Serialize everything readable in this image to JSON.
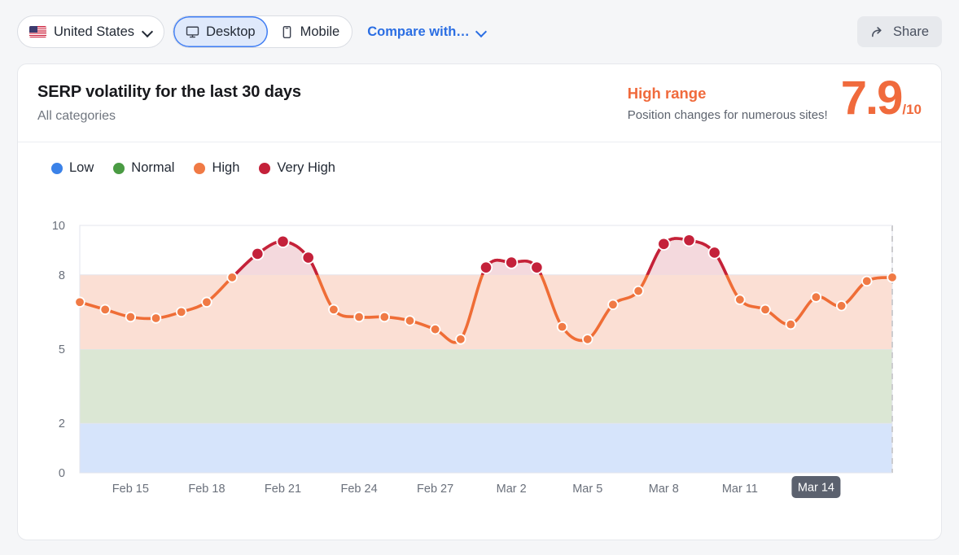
{
  "toolbar": {
    "country": {
      "label": "United States",
      "flag_icon": "us-flag-icon",
      "chevron_icon": "chevron-down-icon"
    },
    "device_desktop": {
      "label": "Desktop",
      "icon": "desktop-monitor-icon",
      "selected": true
    },
    "device_mobile": {
      "label": "Mobile",
      "icon": "mobile-phone-icon",
      "selected": false
    },
    "compare": {
      "label": "Compare with…",
      "chevron_icon": "chevron-down-icon",
      "color": "#2b6ee3"
    },
    "share": {
      "label": "Share",
      "icon": "share-arrow-icon"
    }
  },
  "card": {
    "title": "SERP volatility for the last 30 days",
    "subtitle": "All categories",
    "range_title": "High range",
    "range_desc": "Position changes for numerous sites!",
    "score": "7.9",
    "score_max": "/10",
    "accent_color": "#f06a3c"
  },
  "legend": [
    {
      "label": "Low",
      "color": "#3b82e8"
    },
    {
      "label": "Normal",
      "color": "#4a9b43"
    },
    {
      "label": "High",
      "color": "#f07a45"
    },
    {
      "label": "Very High",
      "color": "#c4213a"
    }
  ],
  "chart_data": {
    "type": "line",
    "title": "SERP volatility for the last 30 days",
    "xlabel": "",
    "ylabel": "",
    "ylim": [
      0,
      10
    ],
    "yticks": [
      0,
      2,
      5,
      8,
      10
    ],
    "grid": true,
    "legend_position": "top-left",
    "xticks": [
      "Feb 15",
      "Feb 18",
      "Feb 21",
      "Feb 24",
      "Feb 27",
      "Mar 2",
      "Mar 5",
      "Mar 8",
      "Mar 11",
      "Mar 14"
    ],
    "highlighted_xtick": "Mar 14",
    "bands": [
      {
        "label": "Low",
        "from": 0,
        "to": 2,
        "color": "#d6e4fb"
      },
      {
        "label": "Normal",
        "from": 2,
        "to": 5,
        "color": "#dbe7d4"
      },
      {
        "label": "High",
        "from": 5,
        "to": 8,
        "color": "#fbdfd4"
      },
      {
        "label": "Very High",
        "from": 8,
        "to": 10,
        "color": "#f4d9dd"
      }
    ],
    "series": [
      {
        "name": "SERP volatility",
        "line_color": "#ef6d36",
        "high_color": "#f07a45",
        "very_high_color": "#c4213a",
        "x": [
          "Feb 13",
          "Feb 14",
          "Feb 15",
          "Feb 16",
          "Feb 17",
          "Feb 18",
          "Feb 19",
          "Feb 20",
          "Feb 21",
          "Feb 22",
          "Feb 23",
          "Feb 24",
          "Feb 25",
          "Feb 26",
          "Feb 27",
          "Feb 28",
          "Mar 1",
          "Mar 2",
          "Mar 3",
          "Mar 4",
          "Mar 5",
          "Mar 6",
          "Mar 7",
          "Mar 8",
          "Mar 9",
          "Mar 10",
          "Mar 11",
          "Mar 12",
          "Mar 13",
          "Mar 14"
        ],
        "values": [
          6.9,
          6.6,
          6.3,
          6.25,
          6.5,
          6.9,
          7.9,
          8.85,
          9.35,
          8.7,
          6.6,
          6.3,
          6.3,
          6.15,
          5.8,
          5.4,
          8.3,
          8.5,
          8.3,
          5.9,
          5.4,
          6.8,
          7.35,
          9.25,
          9.4,
          8.9,
          7.0,
          6.6,
          6.0,
          7.1,
          6.75,
          7.75,
          7.9
        ]
      }
    ]
  }
}
